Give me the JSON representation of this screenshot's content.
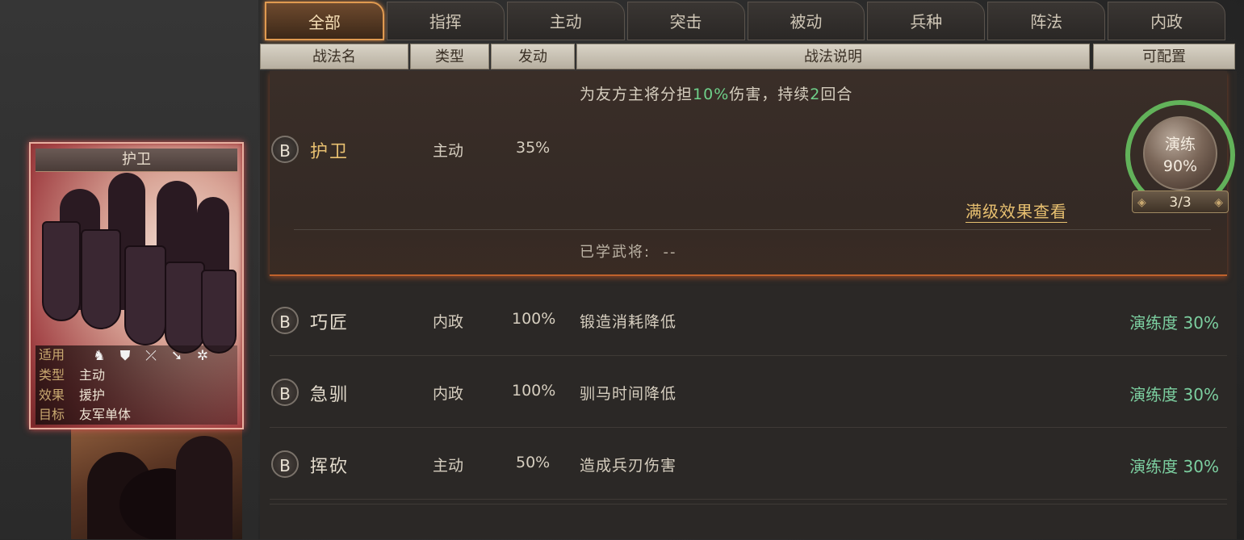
{
  "tabs": [
    {
      "label": "全部",
      "active": true
    },
    {
      "label": "指挥",
      "active": false
    },
    {
      "label": "主动",
      "active": false
    },
    {
      "label": "突击",
      "active": false
    },
    {
      "label": "被动",
      "active": false
    },
    {
      "label": "兵种",
      "active": false
    },
    {
      "label": "阵法",
      "active": false
    },
    {
      "label": "内政",
      "active": false
    }
  ],
  "columns": {
    "name": "战法名",
    "type": "类型",
    "trigger": "发动",
    "description": "战法说明",
    "configurable": "可配置"
  },
  "skill_card": {
    "title": "护卫",
    "applicable_label": "适用",
    "troop_icons": [
      "cavalry-icon",
      "shield-icon",
      "bow-icon",
      "spear-icon",
      "chariot-icon"
    ],
    "type_label": "类型",
    "type_value": "主动",
    "effect_label": "效果",
    "effect_value": "援护",
    "target_label": "目标",
    "target_value": "友军单体"
  },
  "expanded_skill": {
    "grade": "B",
    "name": "护卫",
    "type": "主动",
    "trigger": "35%",
    "desc_part1": "为友方主将分担",
    "desc_pct": "10%",
    "desc_part2": "伤害，持续",
    "desc_turns": "2",
    "desc_part3": "回合",
    "full_level_link": "满级效果查看",
    "learned_label": "已学武将:",
    "learned_value": "--",
    "practice_label": "演练",
    "practice_value": "90%",
    "practice_progress": 0.9,
    "practice_count": "3/3"
  },
  "skills": [
    {
      "grade": "B",
      "name": "巧匠",
      "type": "内政",
      "trigger": "100%",
      "description": "锻造消耗降低",
      "practice": "演练度 30%"
    },
    {
      "grade": "B",
      "name": "急驯",
      "type": "内政",
      "trigger": "100%",
      "description": "驯马时间降低",
      "practice": "演练度 30%"
    },
    {
      "grade": "B",
      "name": "挥砍",
      "type": "主动",
      "trigger": "50%",
      "description": "造成兵刃伤害",
      "practice": "演练度 30%"
    }
  ],
  "colors": {
    "accent": "#e09a50",
    "practice_green": "#6fd08a",
    "gold_text": "#e8c070"
  }
}
